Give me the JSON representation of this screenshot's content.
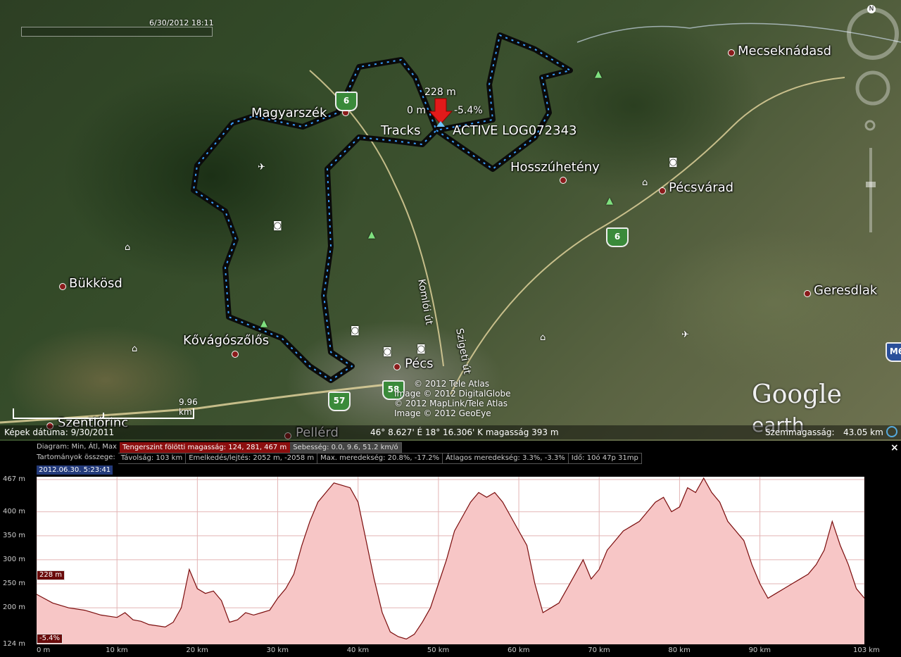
{
  "map": {
    "time_label": "6/30/2012 18:11",
    "places": [
      {
        "name": "Mecseknádasd"
      },
      {
        "name": "Magyarszék"
      },
      {
        "name": "Hosszúhetény"
      },
      {
        "name": "Pécsvárad"
      },
      {
        "name": "Bükkösd"
      },
      {
        "name": "Geresdlak"
      },
      {
        "name": "Kővágószőlős"
      },
      {
        "name": "Pécs"
      },
      {
        "name": "Szentlőrinc"
      },
      {
        "name": "Pellérd"
      }
    ],
    "road_labels": [
      "Komlói út",
      "Szigeti út"
    ],
    "road_shields": [
      "6",
      "6",
      "57",
      "58",
      "M6"
    ],
    "track": {
      "elevation": "228 m",
      "distance": "0 m",
      "slope": "-5.4%",
      "label_left": "Tracks",
      "label_right": "ACTIVE LOG072343",
      "color": "#3aa0ff"
    },
    "copyright_lines": [
      "© 2012 Tele Atlas",
      "Image © 2012 DigitalGlobe",
      "© 2012 MapLink/Tele Atlas",
      "Image © 2012 GeoEye"
    ],
    "logo": {
      "word1": "Google",
      "word2": "earth"
    },
    "scale_label": "9.96 km",
    "status": {
      "image_date": "Képek dátuma: 9/30/2011",
      "coords": "46° 8.627' É   18° 16.306' K  magasság  393 m",
      "eye_alt_label": "Szemmagasság:",
      "eye_alt_value": "43.05 km"
    },
    "nav_letter": "N"
  },
  "panel": {
    "close": "×",
    "row1": {
      "label": "Diagram: Min, Átl, Max",
      "elevation": "Tengerszint fölötti magasság: 124, 281, 467 m",
      "speed": "Sebesség: 0.0, 9.6, 51.2 km/ó"
    },
    "row2": {
      "label": "Tartományok összege:",
      "distance": "Távolság: 103 km",
      "gain": "Emelkedés/lejtés: 2052 m, -2058 m",
      "max_slope": "Max. meredekség: 20.8%, -17.2%",
      "avg_slope": "Átlagos meredekség: 3.3%, -3.3%",
      "time": "Idő: 10ó 47p 31mp"
    },
    "date_badge": "2012.06.30. 5:23:41",
    "cursor_elev_badge": "228 m",
    "cursor_slope_badge": "-5.4%",
    "accent": "#8b0e0e"
  },
  "chart_data": {
    "type": "area",
    "xlabel": "",
    "ylabel": "",
    "xlim": [
      0,
      103
    ],
    "ylim": [
      124,
      467
    ],
    "x_ticks": [
      "0 m",
      "10 km",
      "20 km",
      "30 km",
      "40 km",
      "50 km",
      "60 km",
      "70 km",
      "80 km",
      "90 km",
      "103 km"
    ],
    "x_tick_values": [
      0,
      10,
      20,
      30,
      40,
      50,
      60,
      70,
      80,
      90,
      103
    ],
    "y_ticks": [
      "467 m",
      "400 m",
      "350 m",
      "300 m",
      "250 m",
      "200 m",
      "124 m"
    ],
    "y_tick_values": [
      467,
      400,
      350,
      300,
      250,
      200,
      124
    ],
    "series": [
      {
        "fill": "#f7c6c6",
        "stroke": "#7a0c0c",
        "x": [
          0,
          2,
          4,
          6,
          8,
          10,
          11,
          12,
          13,
          14,
          16,
          17,
          18,
          19,
          20,
          21,
          22,
          23,
          24,
          25,
          26,
          27,
          28,
          29,
          30,
          31,
          32,
          33,
          34,
          35,
          36,
          37,
          38,
          39,
          40,
          41,
          42,
          43,
          44,
          45,
          46,
          47,
          48,
          49,
          50,
          51,
          52,
          53,
          54,
          55,
          56,
          57,
          58,
          59,
          60,
          61,
          62,
          63,
          64,
          65,
          66,
          67,
          68,
          69,
          70,
          71,
          72,
          73,
          74,
          75,
          76,
          77,
          78,
          79,
          80,
          81,
          82,
          83,
          84,
          85,
          86,
          87,
          88,
          89,
          90,
          91,
          92,
          93,
          94,
          95,
          96,
          97,
          98,
          99,
          100,
          101,
          102,
          103
        ],
        "y": [
          228,
          210,
          200,
          195,
          185,
          180,
          190,
          175,
          172,
          165,
          160,
          170,
          200,
          280,
          240,
          230,
          235,
          215,
          170,
          175,
          190,
          185,
          190,
          195,
          220,
          240,
          270,
          330,
          380,
          420,
          440,
          460,
          455,
          450,
          420,
          340,
          260,
          190,
          150,
          140,
          135,
          145,
          170,
          200,
          250,
          300,
          360,
          390,
          420,
          440,
          430,
          440,
          420,
          390,
          360,
          330,
          250,
          190,
          200,
          210,
          240,
          270,
          300,
          260,
          280,
          320,
          340,
          360,
          370,
          380,
          400,
          420,
          430,
          400,
          410,
          450,
          440,
          470,
          440,
          420,
          380,
          360,
          340,
          290,
          250,
          220,
          230,
          240,
          250,
          260,
          270,
          290,
          320,
          380,
          330,
          290,
          240,
          220
        ]
      }
    ]
  }
}
